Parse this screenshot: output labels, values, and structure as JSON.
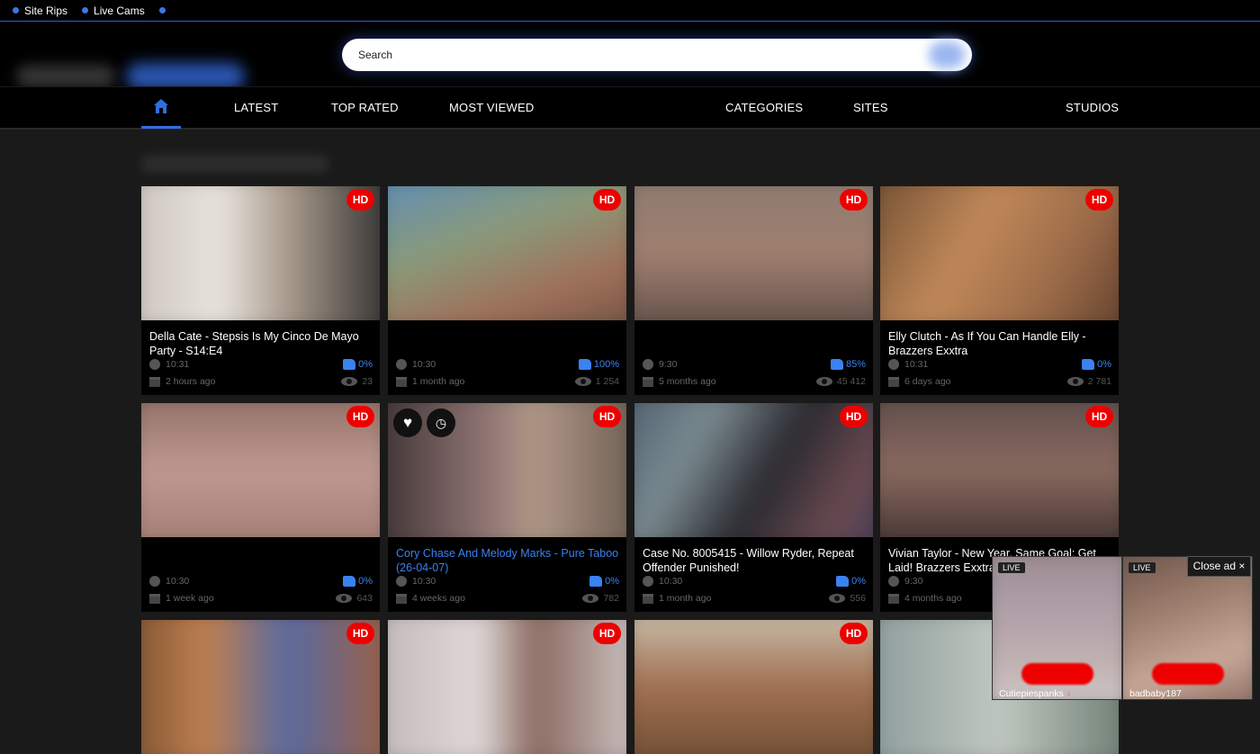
{
  "topbar": {
    "links": [
      "Site Rips",
      "Live Cams",
      ""
    ]
  },
  "search": {
    "placeholder": "Search"
  },
  "nav": {
    "items": [
      "LATEST",
      "TOP RATED",
      "MOST VIEWED",
      "CATEGORIES",
      "SITES",
      "STUDIOS"
    ]
  },
  "videos": [
    {
      "title": "Della Cate - Stepsis Is My Cinco De Mayo Party - S14:E4",
      "duration": "10:31",
      "rating": "0%",
      "age": "2 hours ago",
      "views": "23",
      "badge": "HD"
    },
    {
      "title": "",
      "duration": "10:30",
      "rating": "100%",
      "age": "1 month ago",
      "views": "1 254",
      "badge": "HD"
    },
    {
      "title": "",
      "duration": "9:30",
      "rating": "85%",
      "age": "5 months ago",
      "views": "45 412",
      "badge": "HD"
    },
    {
      "title": "Elly Clutch - As If You Can Handle Elly - Brazzers Exxtra",
      "duration": "10:31",
      "rating": "0%",
      "age": "6 days ago",
      "views": "2 781",
      "badge": "HD"
    },
    {
      "title": "",
      "duration": "10:30",
      "rating": "0%",
      "age": "1 week ago",
      "views": "643",
      "badge": "HD"
    },
    {
      "title": "Cory Chase And Melody Marks - Pure Taboo (26-04-07)",
      "duration": "10:30",
      "rating": "0%",
      "age": "4 weeks ago",
      "views": "782",
      "badge": "HD"
    },
    {
      "title": "Case No. 8005415 - Willow Ryder, Repeat Offender Punished!",
      "duration": "10:30",
      "rating": "0%",
      "age": "1 month ago",
      "views": "556",
      "badge": "HD"
    },
    {
      "title": "Vivian Taylor - New Year, Same Goal: Get Laid! Brazzers Exxtra",
      "duration": "9:30",
      "rating": "",
      "age": "4 months ago",
      "views": "",
      "badge": "HD"
    },
    {
      "badge": "HD"
    },
    {
      "badge": "HD"
    },
    {
      "badge": "HD"
    },
    {
      "badge": ""
    }
  ],
  "ads": [
    {
      "live": "LIVE",
      "username": "Cutiepiespanks"
    },
    {
      "live": "LIVE",
      "username": "badbaby187"
    }
  ],
  "close_ad": "Close ad ×",
  "colors": {
    "accent": "#2f6ee0",
    "badge": "#e00000",
    "background": "#1a1a1a"
  }
}
